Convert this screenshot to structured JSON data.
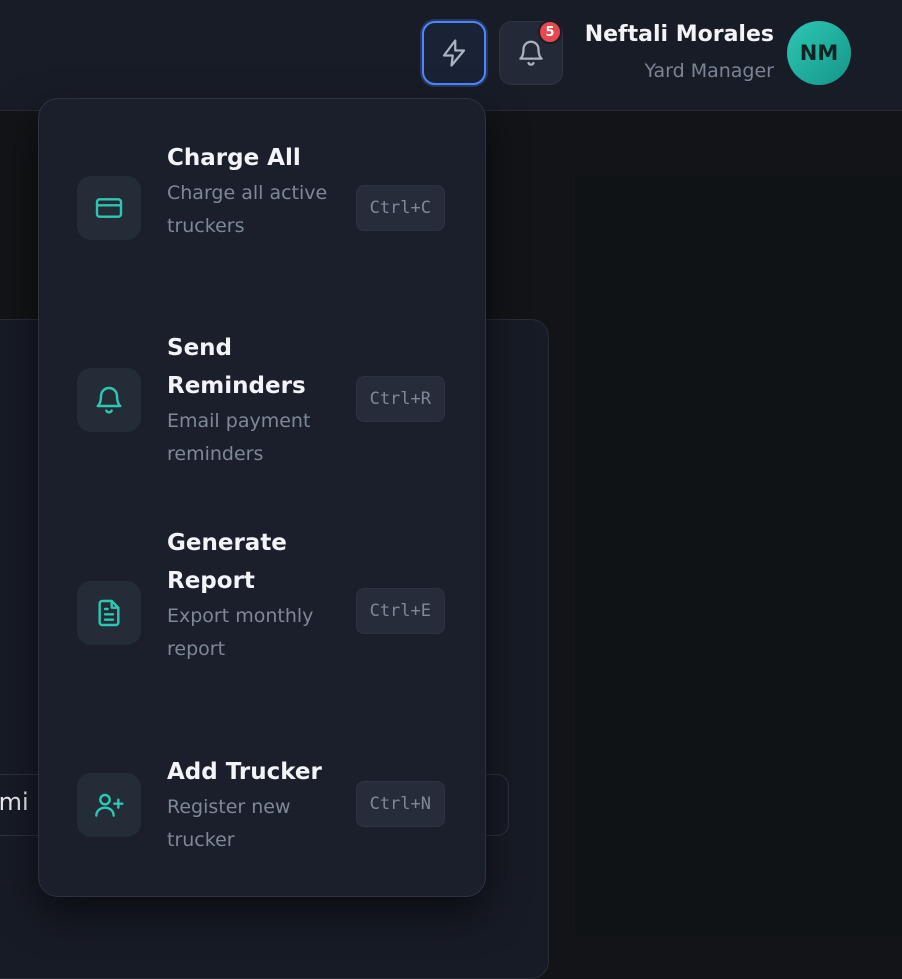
{
  "header": {
    "notification_count": "5",
    "user": {
      "name": "Neftali Morales",
      "role": "Yard Manager",
      "initials": "NM"
    }
  },
  "background": {
    "input_fragment": "lmi"
  },
  "quick_actions": {
    "items": [
      {
        "title": "Charge All",
        "description": "Charge all active truckers",
        "shortcut": "Ctrl+C",
        "icon": "credit-card-icon"
      },
      {
        "title": "Send Reminders",
        "description": "Email payment reminders",
        "shortcut": "Ctrl+R",
        "icon": "bell-icon"
      },
      {
        "title": "Generate Report",
        "description": "Export monthly report",
        "shortcut": "Ctrl+E",
        "icon": "file-text-icon"
      },
      {
        "title": "Add Trucker",
        "description": "Register new trucker",
        "shortcut": "Ctrl+N",
        "icon": "user-plus-icon"
      }
    ]
  },
  "colors": {
    "accent": "#2fc7b4",
    "focus_ring": "#4f86ff",
    "badge": "#e5484d",
    "surface": "#1b1f2c"
  }
}
